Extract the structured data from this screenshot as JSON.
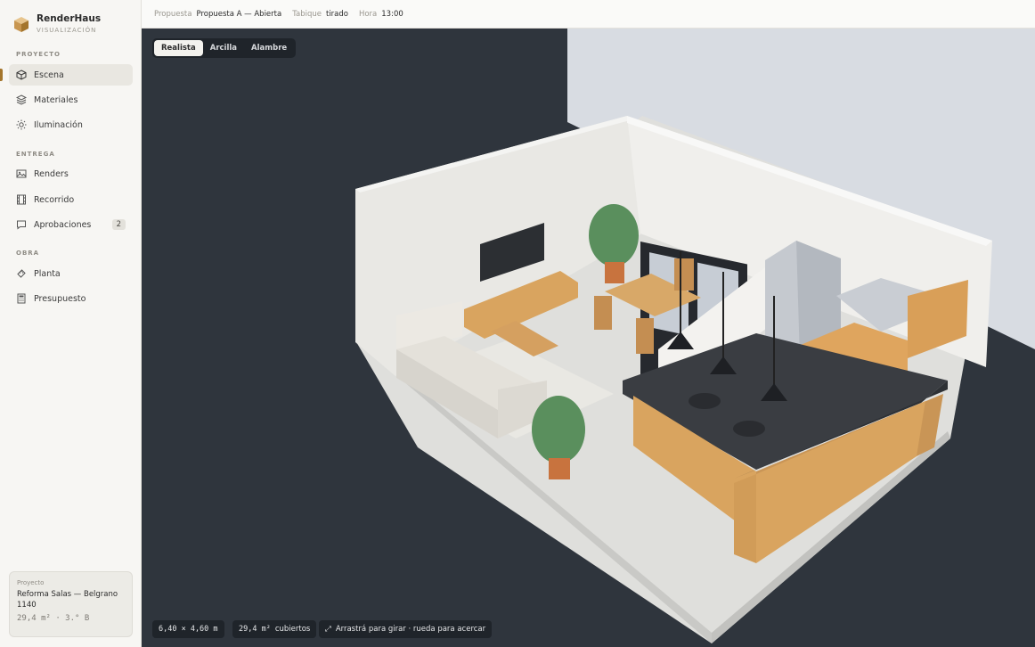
{
  "brand": {
    "name": "RenderHaus",
    "subtitle": "VISUALIZACIÓN"
  },
  "sidebar": {
    "sections": [
      {
        "label": "PROYECTO"
      },
      {
        "label": "ENTREGA"
      },
      {
        "label": "OBRA"
      }
    ],
    "items": [
      {
        "label": "Escena",
        "icon": "cube-icon",
        "active": true
      },
      {
        "label": "Materiales",
        "icon": "layers-icon"
      },
      {
        "label": "Iluminación",
        "icon": "sun-icon"
      },
      {
        "label": "Renders",
        "icon": "image-icon"
      },
      {
        "label": "Recorrido",
        "icon": "film-icon"
      },
      {
        "label": "Aprobaciones",
        "icon": "chat-icon",
        "badge": "2"
      },
      {
        "label": "Planta",
        "icon": "ruler-icon"
      },
      {
        "label": "Presupuesto",
        "icon": "calculator-icon"
      }
    ]
  },
  "project_card": {
    "label": "Proyecto",
    "name": "Reforma Salas — Belgrano 1140",
    "meta": "29,4 m² · 3.° B"
  },
  "topbar": {
    "propuesta_label": "Propuesta",
    "propuesta_value": "Propuesta A — Abierta",
    "tabique_label": "Tabique",
    "tabique_value": "tirado",
    "hora_label": "Hora",
    "hora_value": "13:00"
  },
  "view_modes": [
    "Realista",
    "Arcilla",
    "Alambre"
  ],
  "view_mode_active": "Realista",
  "status_chips": {
    "dimensions": "6,40 × 4,60 m",
    "area_value": "29,4 m²",
    "area_label": "cubiertos",
    "hint": "Arrastrá para girar · rueda para acercar"
  },
  "colors": {
    "accent": "#a4752c",
    "viewport_bg": "#2f353d",
    "wood": "#d9a45f",
    "countertop": "#3a3d42"
  }
}
